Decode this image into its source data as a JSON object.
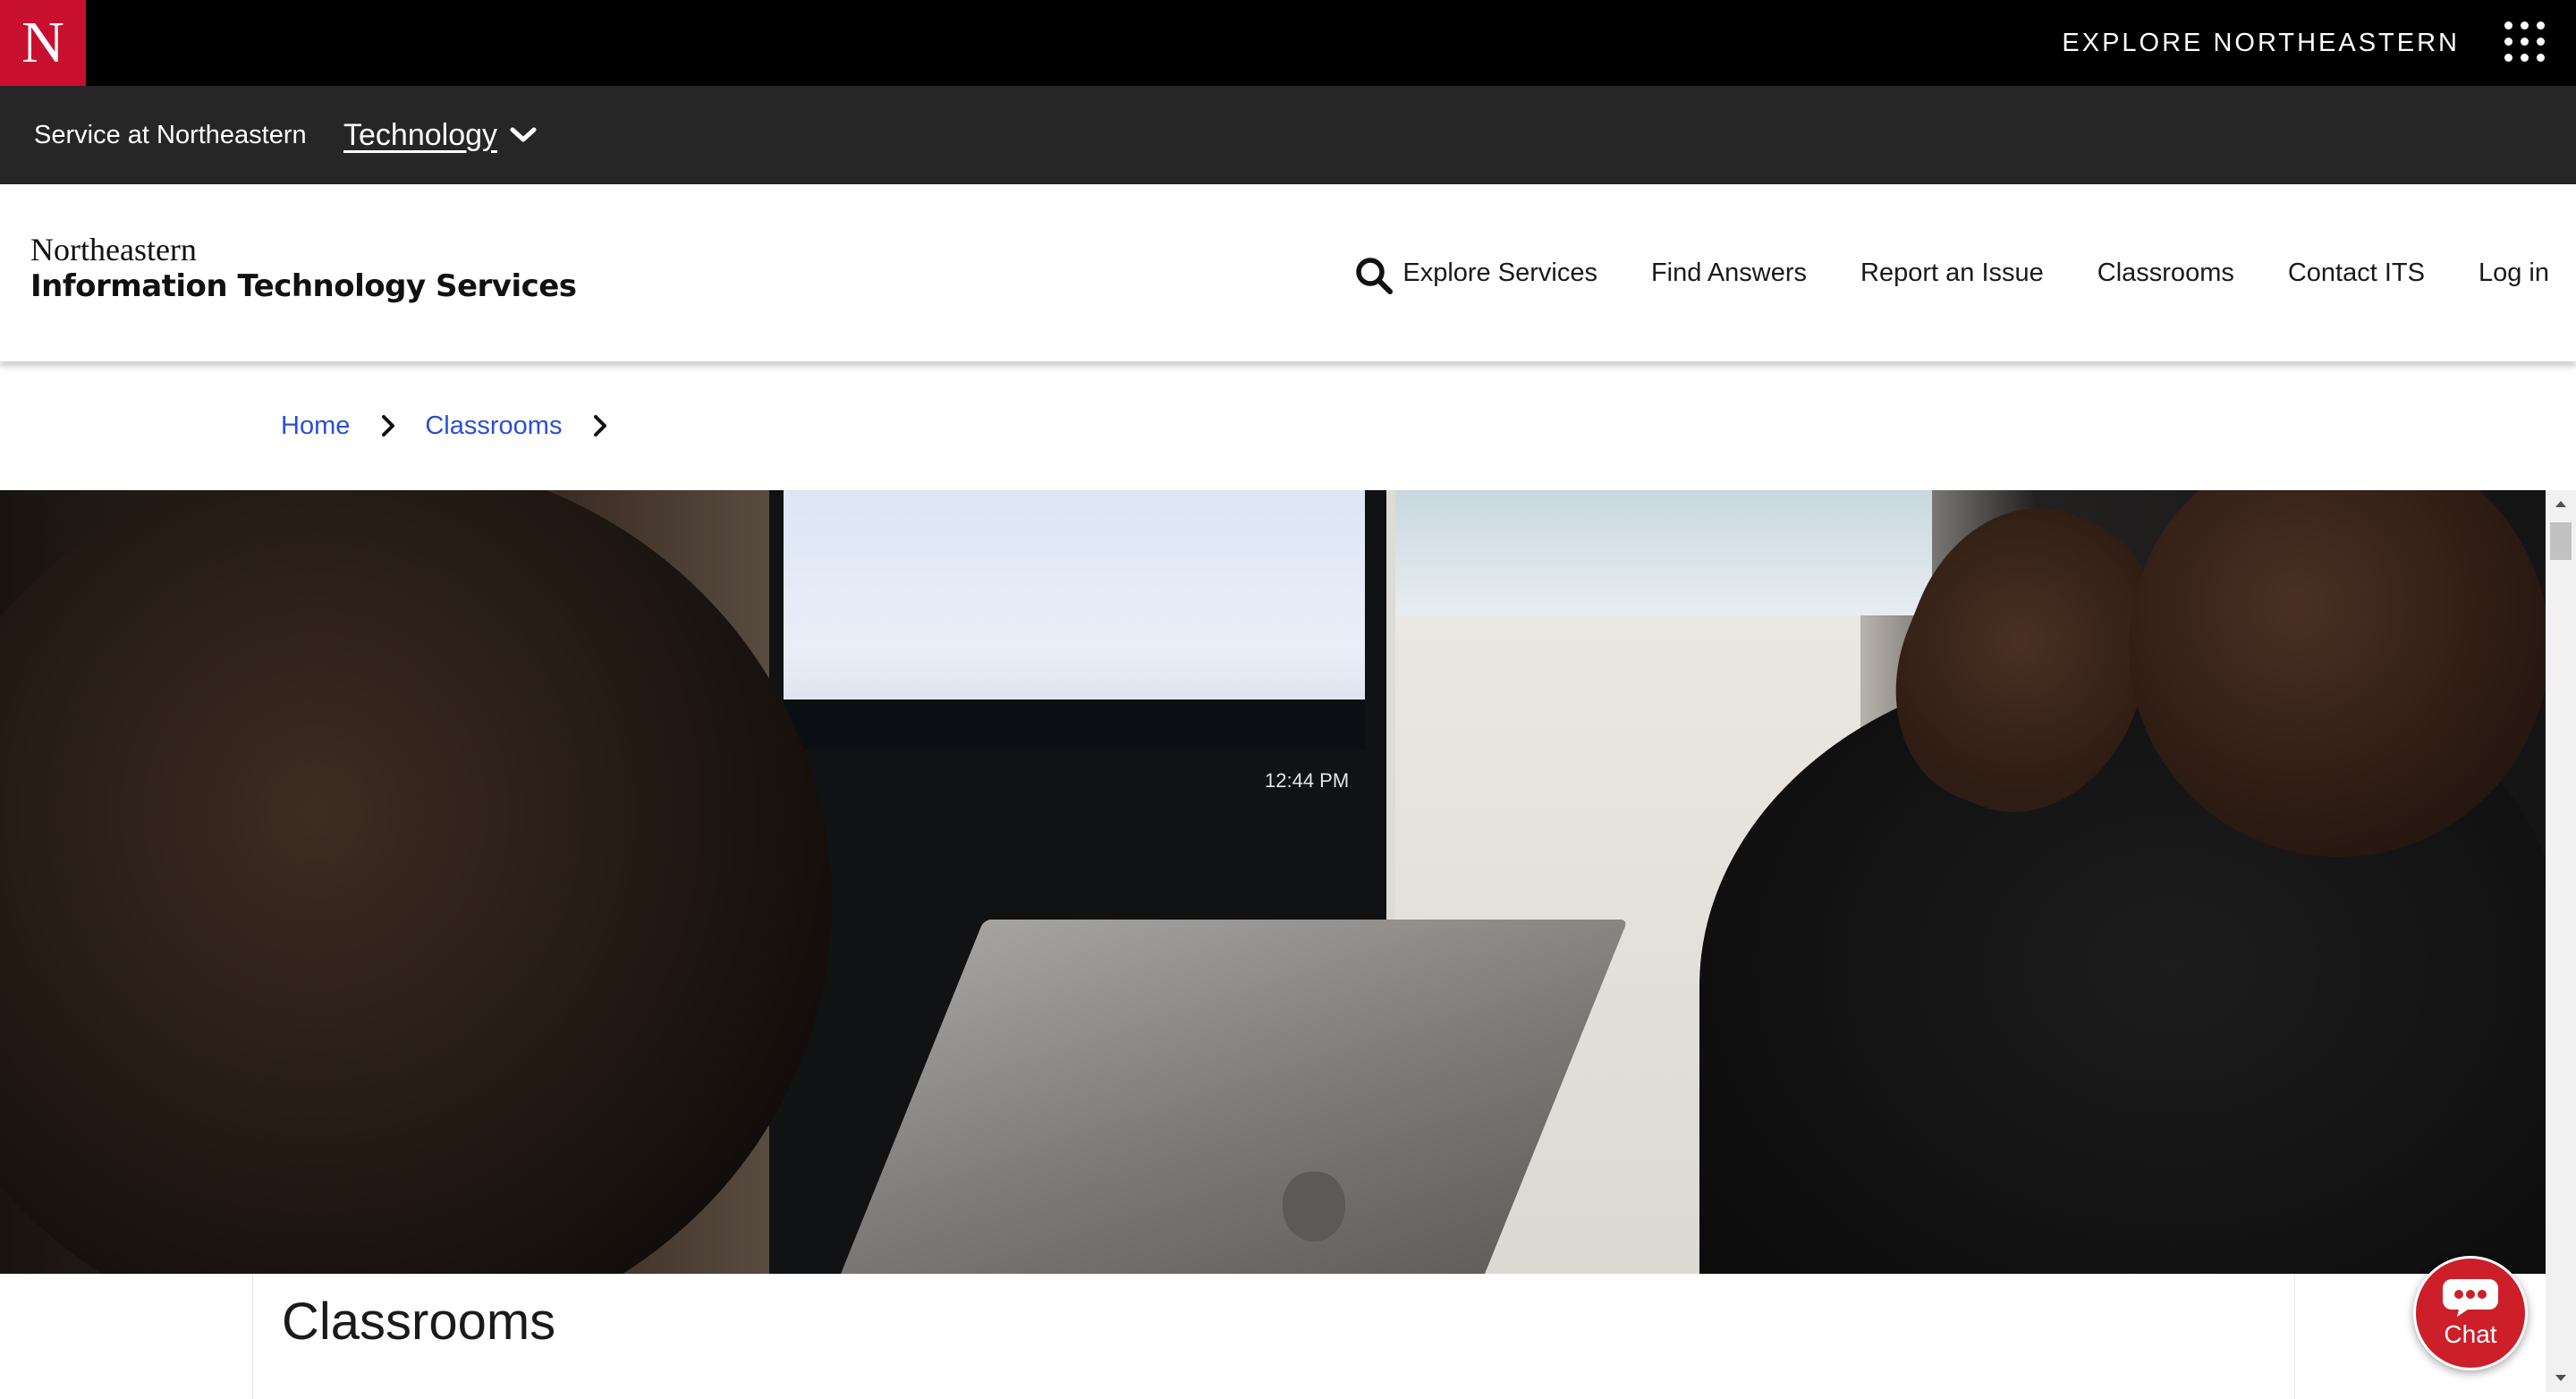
{
  "global_bar": {
    "logo_letter": "N",
    "explore_label": "EXPLORE NORTHEASTERN",
    "apps_icon": "grid-dots-icon"
  },
  "service_bar": {
    "service_label": "Service at Northeastern",
    "dropdown_label": "Technology",
    "dropdown_icon": "chevron-down-icon"
  },
  "header": {
    "logo_line1": "Northeastern",
    "logo_line2": "Information Technology Services",
    "search_icon": "search-icon",
    "nav": [
      {
        "label": "Explore Services"
      },
      {
        "label": "Find Answers"
      },
      {
        "label": "Report an Issue"
      },
      {
        "label": "Classrooms"
      },
      {
        "label": "Contact ITS"
      },
      {
        "label": "Log in"
      }
    ]
  },
  "breadcrumb": {
    "items": [
      {
        "label": "Home"
      },
      {
        "label": "Classrooms"
      }
    ],
    "separator_icon": "chevron-right-icon"
  },
  "hero": {
    "monitor_time": "12:44 PM"
  },
  "page": {
    "title": "Classrooms"
  },
  "chat": {
    "label": "Chat",
    "icon": "chat-bubble-icon"
  },
  "colors": {
    "brand_red": "#c8102e",
    "global_bar": "#000000",
    "service_bar": "#262626",
    "link_blue": "#2a4fd0",
    "chat_red": "#cc1f2a"
  }
}
